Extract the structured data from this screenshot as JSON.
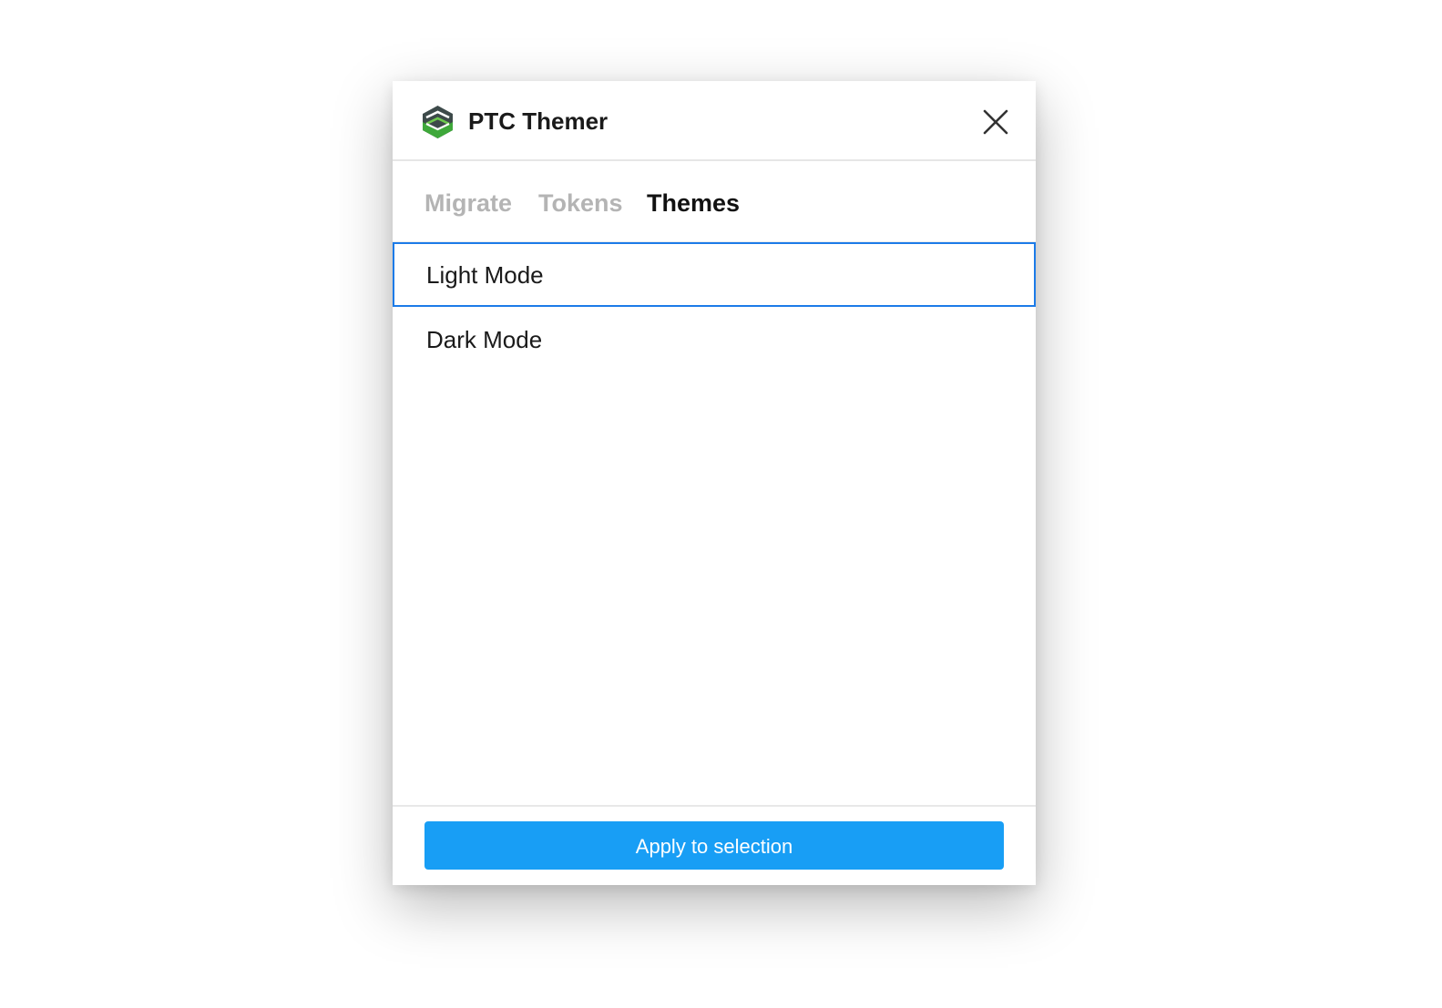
{
  "window": {
    "title": "PTC Themer",
    "logo_icon": "ptc-themer-logo-icon",
    "close_icon": "close-icon"
  },
  "tabs": [
    {
      "label": "Migrate",
      "active": false
    },
    {
      "label": "Tokens",
      "active": false
    },
    {
      "label": "Themes",
      "active": true
    }
  ],
  "themes": [
    {
      "label": "Light Mode",
      "selected": true
    },
    {
      "label": "Dark Mode",
      "selected": false
    }
  ],
  "footer": {
    "apply_label": "Apply to selection"
  },
  "colors": {
    "accent_button": "#189ef5",
    "selection_border": "#1c7be8",
    "logo_dark": "#3d4a4a",
    "logo_green": "#3ea83a"
  }
}
